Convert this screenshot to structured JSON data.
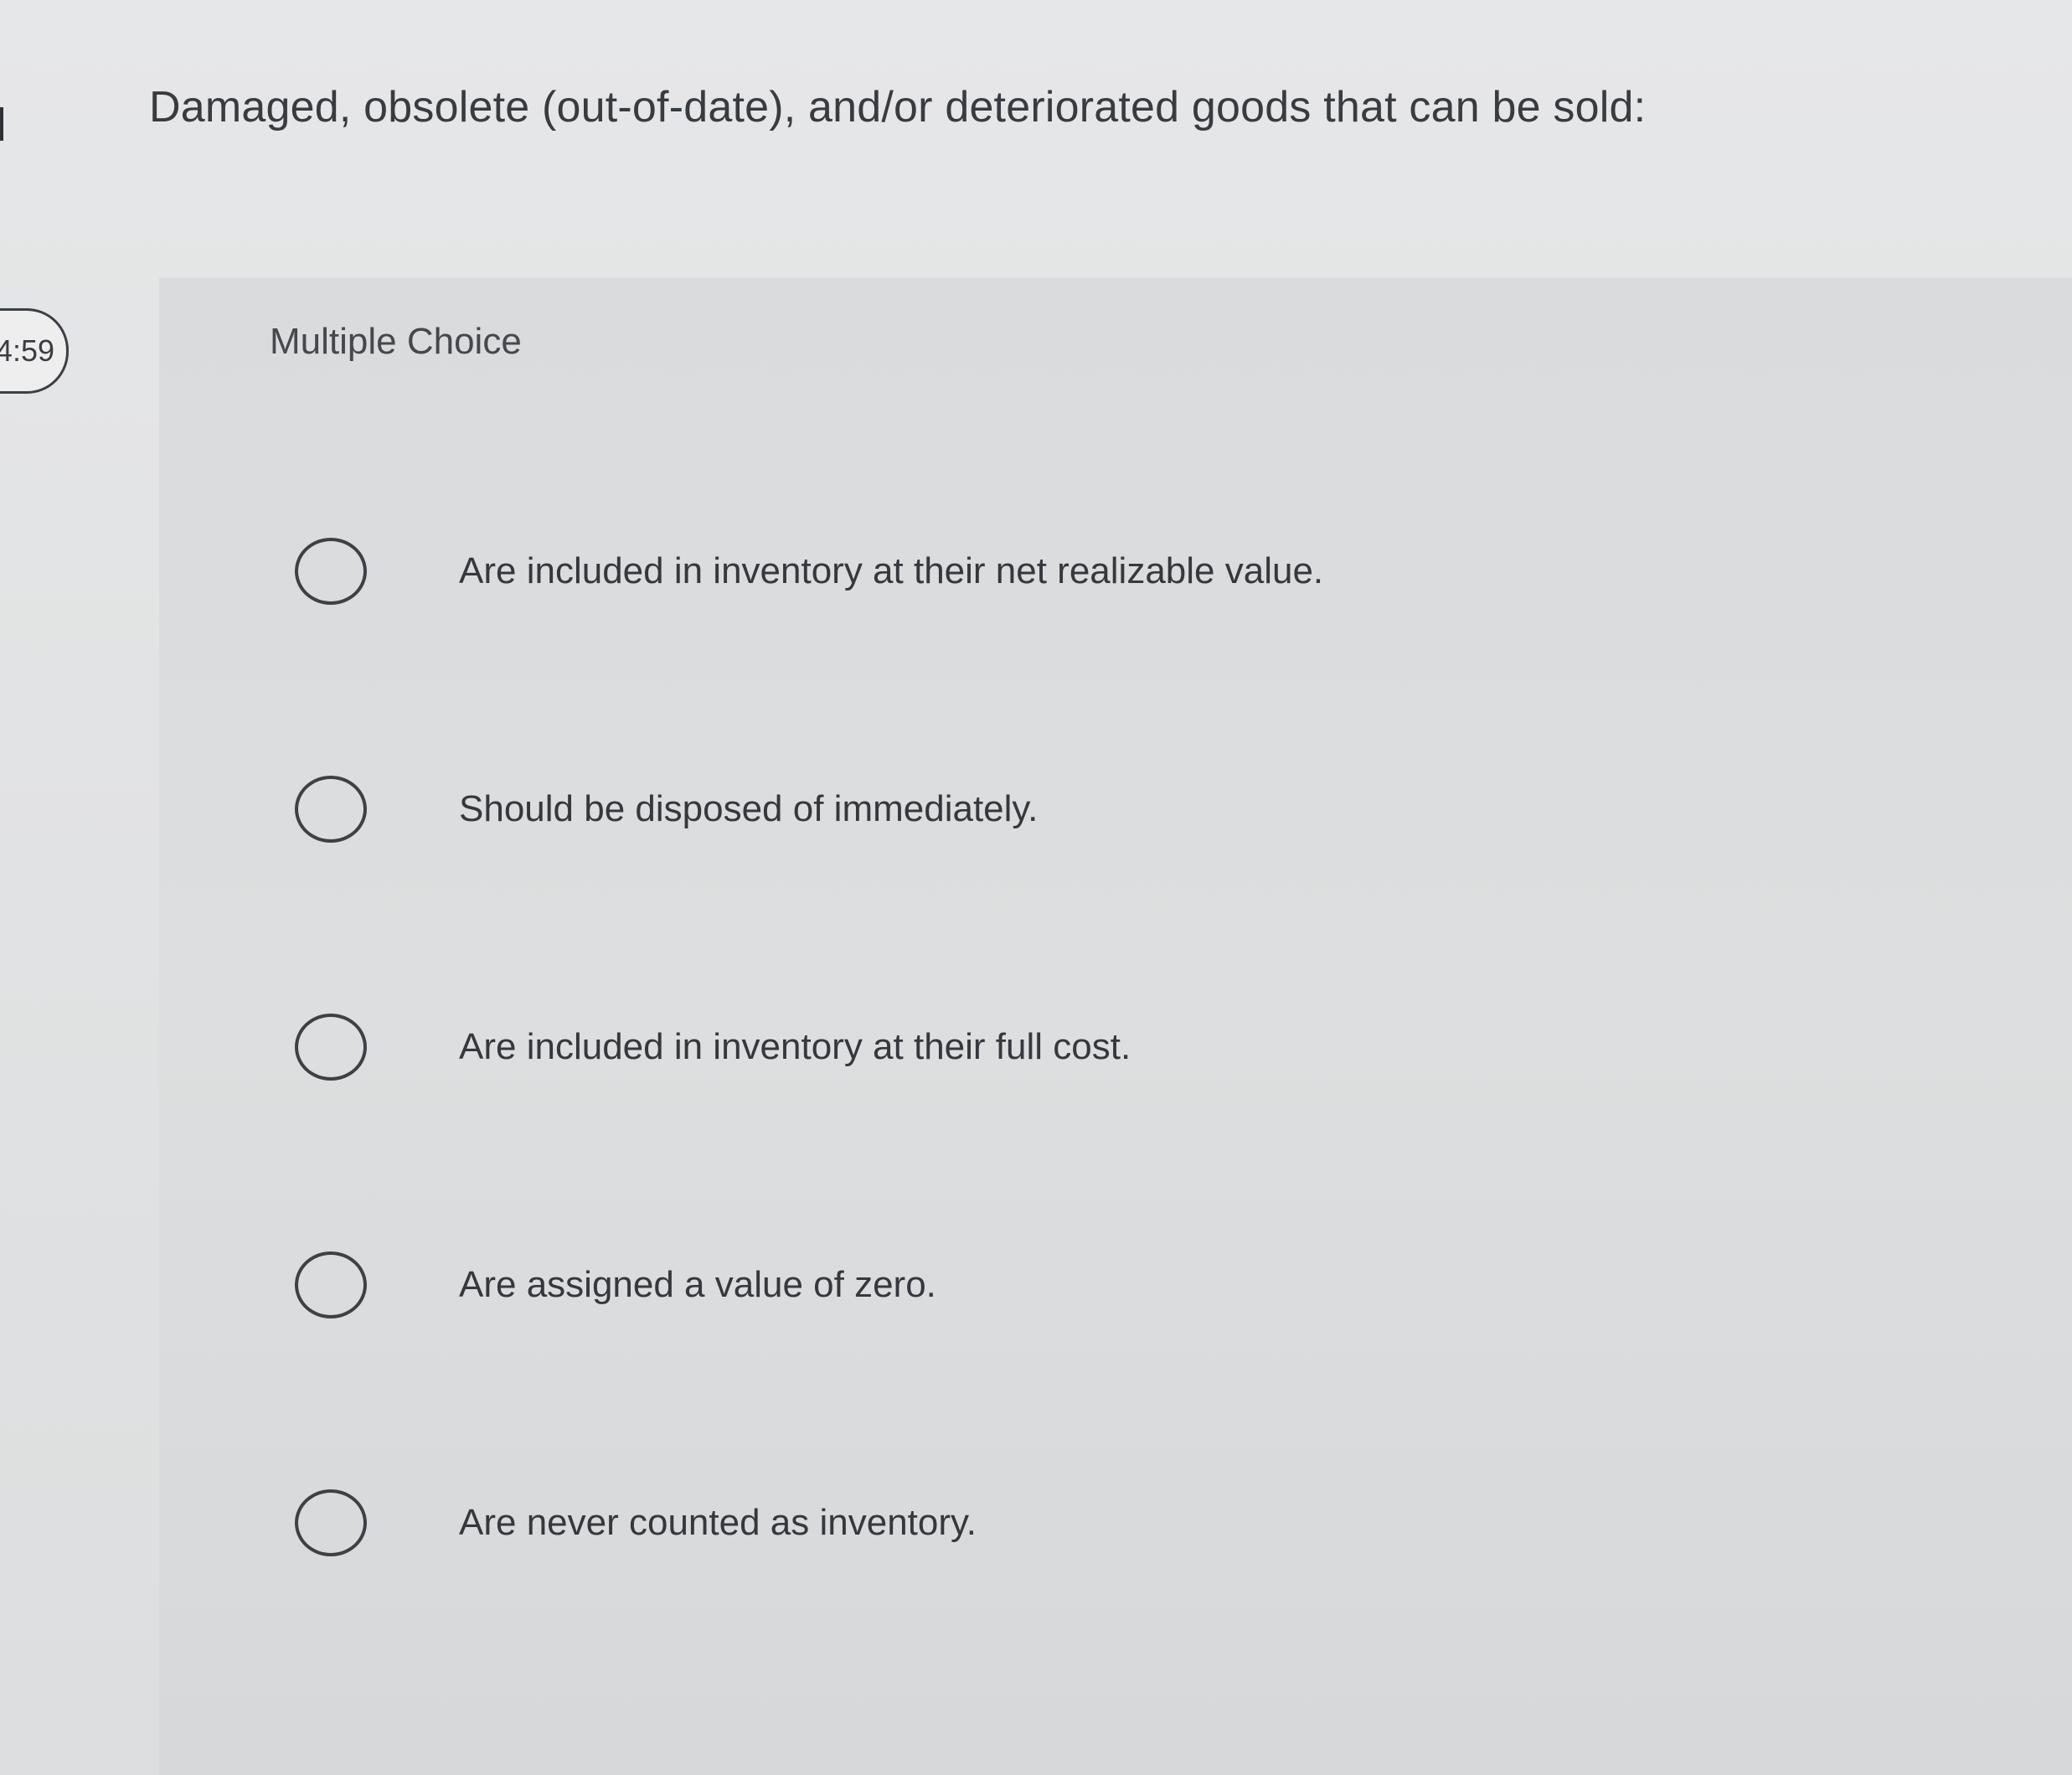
{
  "timer": {
    "text": "4:59"
  },
  "question": {
    "text": "Damaged, obsolete (out-of-date), and/or deteriorated goods that can be sold:"
  },
  "question_type": "Multiple Choice",
  "options": [
    {
      "label": "Are included in inventory at their net realizable value.",
      "selected": false
    },
    {
      "label": "Should be disposed of immediately.",
      "selected": false
    },
    {
      "label": "Are included in inventory at their full cost.",
      "selected": false
    },
    {
      "label": "Are assigned a value of zero.",
      "selected": false
    },
    {
      "label": "Are never counted as inventory.",
      "selected": false
    }
  ],
  "icons": {
    "option_marker": "radio-button-icon"
  },
  "colors": {
    "text": "#383b40",
    "background": "#e2e3e4",
    "panel": "#d9dbdd"
  }
}
